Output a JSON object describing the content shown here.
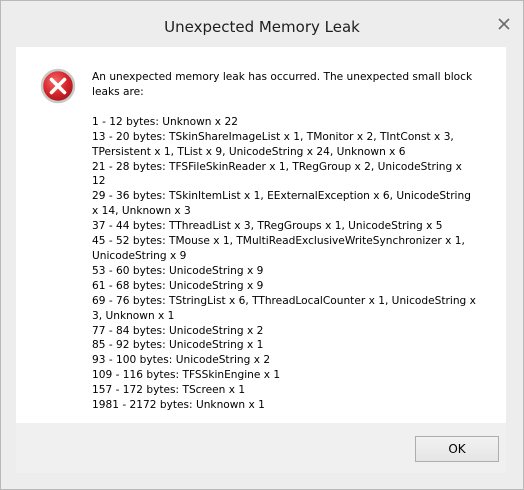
{
  "window": {
    "title": "Unexpected Memory Leak",
    "close_icon": "close-icon"
  },
  "dialog": {
    "icon": "error-icon",
    "intro": "An unexpected memory leak has occurred. The unexpected small block leaks are:",
    "leaks": [
      "1 - 12 bytes: Unknown x 22",
      "13 - 20 bytes: TSkinShareImageList x 1, TMonitor x 2, TIntConst x 3, TPersistent x 1, TList x 9, UnicodeString x 24, Unknown x 6",
      "21 - 28 bytes: TFSFileSkinReader x 1, TRegGroup x 2, UnicodeString x 12",
      "29 - 36 bytes: TSkinItemList x 1, EExternalException x 6, UnicodeString x 14, Unknown x 3",
      "37 - 44 bytes: TThreadList x 3, TRegGroups x 1, UnicodeString x 5",
      "45 - 52 bytes: TMouse x 1, TMultiReadExclusiveWriteSynchronizer x 1, UnicodeString x 9",
      "53 - 60 bytes: UnicodeString x 9",
      "61 - 68 bytes: UnicodeString x 9",
      "69 - 76 bytes: TStringList x 6, TThreadLocalCounter x 1, UnicodeString x 3, Unknown x 1",
      "77 - 84 bytes: UnicodeString x 2",
      "85 - 92 bytes: UnicodeString x 1",
      "93 - 100 bytes: UnicodeString x 2",
      "109 - 116 bytes: TFSSkinEngine x 1",
      "157 - 172 bytes: TScreen x 1",
      "1981 - 2172 bytes: Unknown x 1"
    ],
    "ok_label": "OK"
  },
  "colors": {
    "error_red": "#d9262a",
    "window_bg": "#ededed",
    "client_bg": "#ffffff"
  }
}
